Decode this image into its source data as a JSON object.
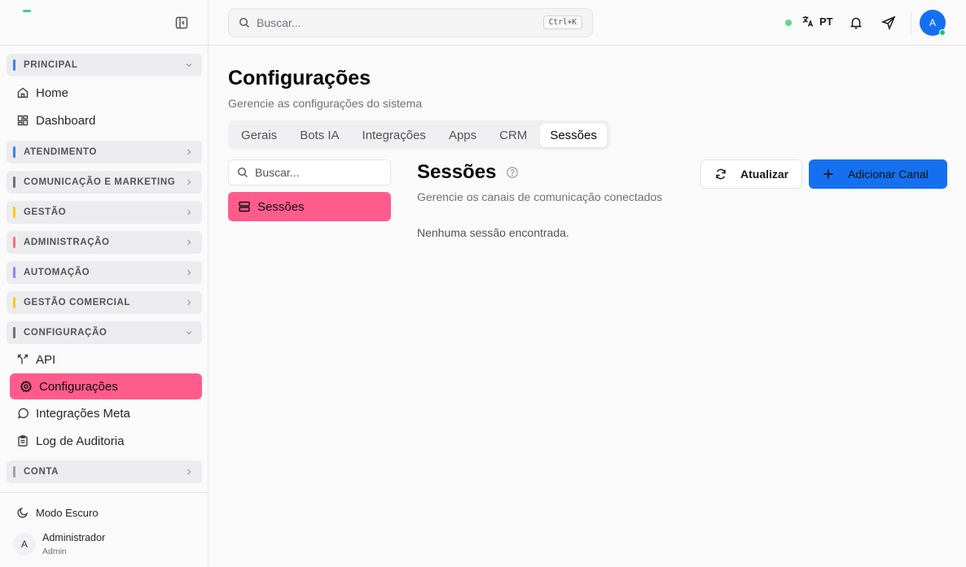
{
  "sidebar": {
    "sections": [
      {
        "label": "PRINCIPAL",
        "color": "#3b82f6",
        "items": [
          "Home",
          "Dashboard"
        ]
      },
      {
        "label": "ATENDIMENTO",
        "color": "#3b82f6"
      },
      {
        "label": "COMUNICAÇÃO E MARKETING",
        "color": "#71717a"
      },
      {
        "label": "GESTÃO",
        "color": "#facc15"
      },
      {
        "label": "ADMINISTRAÇÃO",
        "color": "#f87171"
      },
      {
        "label": "AUTOMAÇÃO",
        "color": "#818cf8"
      },
      {
        "label": "GESTÃO COMERCIAL",
        "color": "#facc15"
      },
      {
        "label": "CONFIGURAÇÃO",
        "color": "#71717a",
        "items": [
          "API",
          "Configurações",
          "Integrações Meta",
          "Log de Auditoria"
        ]
      },
      {
        "label": "CONTA",
        "color": "#a1a1aa"
      }
    ],
    "active_item": "Configurações",
    "active_color": "#ff5c8d",
    "dark_mode_label": "Modo Escuro",
    "user": {
      "initial": "A",
      "name": "Administrador",
      "role": "Admin"
    }
  },
  "header": {
    "search_placeholder": "Buscar...",
    "shortcut": "Ctrl+K",
    "language": "PT",
    "avatar_initial": "A",
    "accent": "#1570ef"
  },
  "main": {
    "title": "Configurações",
    "subtitle": "Gerencie as configurações do sistema",
    "tabs": [
      "Gerais",
      "Bots IA",
      "Integrações",
      "Apps",
      "CRM",
      "Sessões"
    ],
    "active_tab": "Sessões",
    "side_search_placeholder": "Buscar...",
    "side_item": "Sessões",
    "section_title": "Sessões",
    "section_subtitle": "Gerencie os canais de comunicação conectados",
    "empty_message": "Nenhuma sessão encontrada.",
    "refresh_label": "Atualizar",
    "add_label": "Adicionar Canal"
  }
}
